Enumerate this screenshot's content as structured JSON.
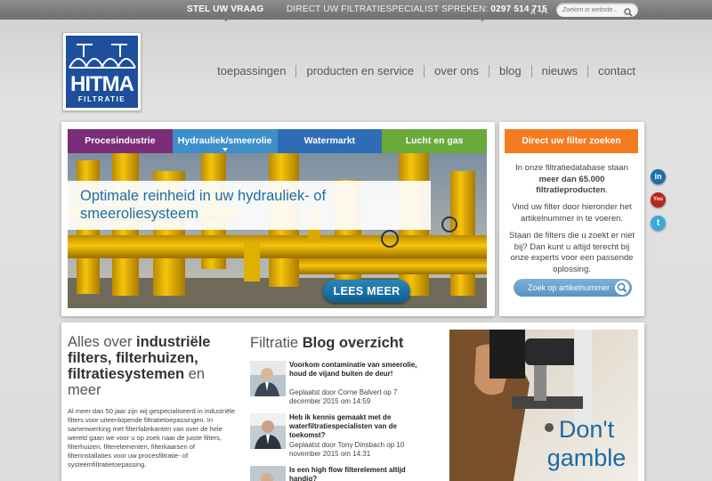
{
  "topbar": {
    "ask_label": "STEL UW VRAAG",
    "phone_label": "DIRECT UW FILTRATIESPECIALIST SPREKEN:",
    "phone_number": "0297 514 715",
    "font_small": "A",
    "font_large": "A",
    "search_placeholder": "Zoeken in website..."
  },
  "logo": {
    "name": "HITMA",
    "sub": "FILTRATIE"
  },
  "nav": {
    "items": [
      "toepassingen",
      "producten en service",
      "over ons",
      "blog",
      "nieuws",
      "contact"
    ]
  },
  "hero": {
    "tabs": [
      {
        "label": "Procesindustrie",
        "color": "#7b2c78"
      },
      {
        "label": "Hydrauliek/smeerolie",
        "color": "#3d8fc9"
      },
      {
        "label": "Watermarkt",
        "color": "#2e6cb5"
      },
      {
        "label": "Lucht en gas",
        "color": "#6aaa3b"
      }
    ],
    "headline": "Optimale reinheid in uw hydrauliek- of smeeroliesysteem",
    "cta_label": "LEES MEER"
  },
  "finder": {
    "title": "Direct uw filter zoeken",
    "p1_pre": "In onze filtratiedatabase staan",
    "p1_bold": "meer dan 65.000 filtratieproducten",
    "p1_post": ".",
    "p2": "Vind uw filter door hieronder het artikelnummer in te voeren.",
    "p3": "Staan de filters die u zoekt er niet bij? Dan kunt u altijd terecht bij onze experts voor een passende oplossing.",
    "button_label": "Zoek op artikelnummer"
  },
  "social": {
    "linkedin": "in",
    "youtube": "You",
    "twitter": "t"
  },
  "intro": {
    "title_pre": "Alles over",
    "title_bold": "industriële filters, filterhuizen, filtratiesystemen",
    "title_mid": "en",
    "title_post": "meer",
    "text": "Al meer dan 50 jaar zijn wij gespecialiseerd in industriële filters voor uiteenlopende filtratietoepassingen. In samenwerking met filterfabrikanten van over de hele wereld gaan we voor u op zoek naar de juiste filters, filterhuizen, filterelementen, filterkaarsen of filterinstallaties voor uw procesfiltratie- of systeemfiltratietoepassing."
  },
  "blog": {
    "title_pre": "Filtratie",
    "title_bold": "Blog overzicht",
    "posts": [
      {
        "title": "Voorkom contaminatie van smeerolie, houd de vijand buiten de deur!",
        "meta": "Geplaatst door Corne Balvert op 7 december 2015 om 14:59"
      },
      {
        "title": "Heb ik kennis gemaakt met de waterfiltratiespecialisten van de toekomst?",
        "meta": "Geplaatst door Tony Dinsbach op 10 november 2015 om 14:31"
      },
      {
        "title": "Is een high flow filterelement altijd handig?",
        "meta": ""
      }
    ]
  },
  "ad": {
    "text": "Don't gamble"
  }
}
